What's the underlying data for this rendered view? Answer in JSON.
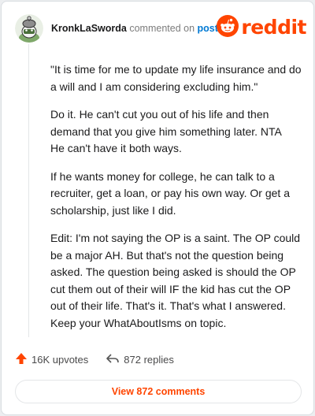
{
  "header": {
    "author": "KronkLaSworda",
    "action_text": "commented on",
    "post_link": "post",
    "logo_wordmark": "reddit",
    "avatar_icon": "snoo-avatar-icon",
    "logo_icon": "reddit-snoo-icon"
  },
  "comment": {
    "paragraphs": [
      "\"It is time for me to update my life insurance and do a will and I am considering excluding him.\"",
      "Do it. He can't cut you out of his life and then demand that you give him something later. NTA\nHe can't have it both ways.",
      "If he wants money for college, he can talk to a recruiter, get a loan, or pay his own way. Or get a scholarship, just like I did.",
      "Edit: I'm not saying the OP is a saint. The OP could be a major AH. But that's not the question being asked. The question being asked is should the OP cut them out of their will IF the kid has cut the OP out of their life. That's it. That's what I answered. Keep your WhatAboutIsms on topic."
    ]
  },
  "footer": {
    "upvotes": "16K upvotes",
    "replies": "872 replies",
    "upvote_icon": "upvote-arrow-icon",
    "reply_icon": "reply-arrow-icon"
  },
  "view_button": {
    "label": "View 872 comments"
  },
  "colors": {
    "brand": "#ff4500",
    "link": "#0079d3",
    "text": "#1a1a1b",
    "muted": "#7c7c7c"
  }
}
